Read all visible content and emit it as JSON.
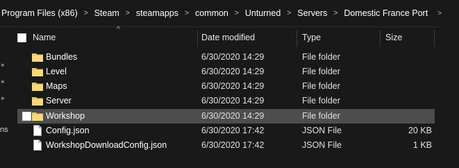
{
  "breadcrumb": {
    "parts": [
      "Program Files (x86)",
      "Steam",
      "steamapps",
      "common",
      "Unturned",
      "Servers",
      "Domestic France Port"
    ]
  },
  "nav": {
    "partial_label": "ns"
  },
  "columns": {
    "name": "Name",
    "date": "Date modified",
    "type": "Type",
    "size": "Size"
  },
  "files": [
    {
      "name": "Bundles",
      "date": "6/30/2020 14:29",
      "type": "File folder",
      "size": "",
      "icon": "folder-icon"
    },
    {
      "name": "Level",
      "date": "6/30/2020 14:29",
      "type": "File folder",
      "size": "",
      "icon": "folder-icon"
    },
    {
      "name": "Maps",
      "date": "6/30/2020 14:29",
      "type": "File folder",
      "size": "",
      "icon": "folder-icon"
    },
    {
      "name": "Server",
      "date": "6/30/2020 14:29",
      "type": "File folder",
      "size": "",
      "icon": "folder-icon"
    },
    {
      "name": "Workshop",
      "date": "6/30/2020 14:29",
      "type": "File folder",
      "size": "",
      "icon": "folder-icon",
      "selected": true
    },
    {
      "name": "Config.json",
      "date": "6/30/2020 17:42",
      "type": "JSON File",
      "size": "20 KB",
      "icon": "file-icon"
    },
    {
      "name": "WorkshopDownloadConfig.json",
      "date": "6/30/2020 17:42",
      "type": "JSON File",
      "size": "1 KB",
      "icon": "file-icon"
    }
  ],
  "colors": {
    "background": "#191919",
    "selected_row": "#4d4d4d",
    "folder": "#f0c85a"
  }
}
